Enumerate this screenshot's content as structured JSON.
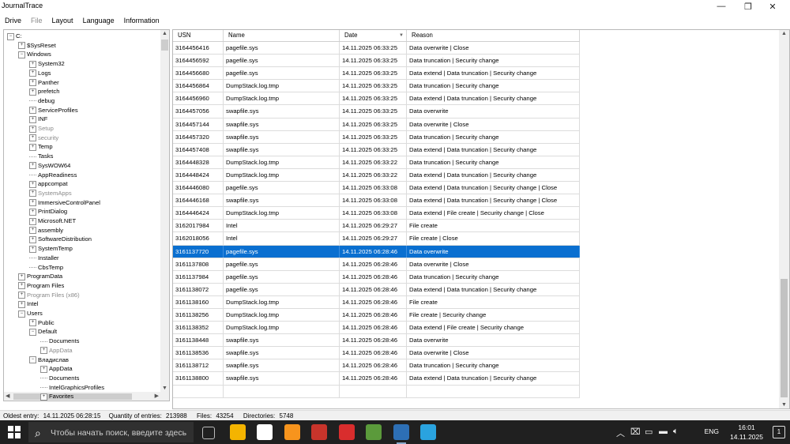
{
  "app": {
    "title": "JournalTrace"
  },
  "window_controls": {
    "minimize": "—",
    "maximize": "❐",
    "close": "✕"
  },
  "menu": [
    {
      "label": "Drive",
      "enabled": true
    },
    {
      "label": "File",
      "enabled": false
    },
    {
      "label": "Layout",
      "enabled": true
    },
    {
      "label": "Language",
      "enabled": true
    },
    {
      "label": "Information",
      "enabled": true
    }
  ],
  "tree": [
    {
      "label": "C:",
      "depth": 0,
      "exp": "−"
    },
    {
      "label": "$SysReset",
      "depth": 1,
      "exp": "+"
    },
    {
      "label": "Windows",
      "depth": 1,
      "exp": "−"
    },
    {
      "label": "System32",
      "depth": 2,
      "exp": "+"
    },
    {
      "label": "Logs",
      "depth": 2,
      "exp": "+"
    },
    {
      "label": "Panther",
      "depth": 2,
      "exp": "+"
    },
    {
      "label": "prefetch",
      "depth": 2,
      "exp": "+"
    },
    {
      "label": "debug",
      "depth": 2,
      "exp": ""
    },
    {
      "label": "ServiceProfiles",
      "depth": 2,
      "exp": "+"
    },
    {
      "label": "INF",
      "depth": 2,
      "exp": "+"
    },
    {
      "label": "Setup",
      "depth": 2,
      "exp": "+",
      "disabled": true
    },
    {
      "label": "security",
      "depth": 2,
      "exp": "+",
      "disabled": true
    },
    {
      "label": "Temp",
      "depth": 2,
      "exp": "+"
    },
    {
      "label": "Tasks",
      "depth": 2,
      "exp": ""
    },
    {
      "label": "SysWOW64",
      "depth": 2,
      "exp": "+"
    },
    {
      "label": "AppReadiness",
      "depth": 2,
      "exp": ""
    },
    {
      "label": "appcompat",
      "depth": 2,
      "exp": "+"
    },
    {
      "label": "SystemApps",
      "depth": 2,
      "exp": "+",
      "disabled": true
    },
    {
      "label": "ImmersiveControlPanel",
      "depth": 2,
      "exp": "+"
    },
    {
      "label": "PrintDialog",
      "depth": 2,
      "exp": "+"
    },
    {
      "label": "Microsoft.NET",
      "depth": 2,
      "exp": "+"
    },
    {
      "label": "assembly",
      "depth": 2,
      "exp": "+"
    },
    {
      "label": "SoftwareDistribution",
      "depth": 2,
      "exp": "+"
    },
    {
      "label": "SystemTemp",
      "depth": 2,
      "exp": "+"
    },
    {
      "label": "Installer",
      "depth": 2,
      "exp": ""
    },
    {
      "label": "CbsTemp",
      "depth": 2,
      "exp": ""
    },
    {
      "label": "ProgramData",
      "depth": 1,
      "exp": "+"
    },
    {
      "label": "Program Files",
      "depth": 1,
      "exp": "+"
    },
    {
      "label": "Program Files (x86)",
      "depth": 1,
      "exp": "+",
      "disabled": true
    },
    {
      "label": "Intel",
      "depth": 1,
      "exp": "+"
    },
    {
      "label": "Users",
      "depth": 1,
      "exp": "−"
    },
    {
      "label": "Public",
      "depth": 2,
      "exp": "+"
    },
    {
      "label": "Default",
      "depth": 2,
      "exp": "−"
    },
    {
      "label": "Documents",
      "depth": 3,
      "exp": ""
    },
    {
      "label": "AppData",
      "depth": 3,
      "exp": "+",
      "disabled": true
    },
    {
      "label": "Владислав",
      "depth": 2,
      "exp": "−"
    },
    {
      "label": "AppData",
      "depth": 3,
      "exp": "+"
    },
    {
      "label": "Documents",
      "depth": 3,
      "exp": ""
    },
    {
      "label": "IntelGraphicsProfiles",
      "depth": 3,
      "exp": ""
    },
    {
      "label": "Favorites",
      "depth": 3,
      "exp": "+"
    }
  ],
  "grid": {
    "columns": [
      "USN",
      "Name",
      "Date",
      "Reason"
    ],
    "sort_indicator": "▼",
    "selected_index": 17,
    "rows": [
      [
        "3164456416",
        "pagefile.sys",
        "14.11.2025 06:33:25",
        "Data overwrite | Close"
      ],
      [
        "3164456592",
        "pagefile.sys",
        "14.11.2025 06:33:25",
        "Data truncation | Security change"
      ],
      [
        "3164456680",
        "pagefile.sys",
        "14.11.2025 06:33:25",
        "Data extend | Data truncation | Security change"
      ],
      [
        "3164456864",
        "DumpStack.log.tmp",
        "14.11.2025 06:33:25",
        "Data truncation | Security change"
      ],
      [
        "3164456960",
        "DumpStack.log.tmp",
        "14.11.2025 06:33:25",
        "Data extend | Data truncation | Security change"
      ],
      [
        "3164457056",
        "swapfile.sys",
        "14.11.2025 06:33:25",
        "Data overwrite"
      ],
      [
        "3164457144",
        "swapfile.sys",
        "14.11.2025 06:33:25",
        "Data overwrite | Close"
      ],
      [
        "3164457320",
        "swapfile.sys",
        "14.11.2025 06:33:25",
        "Data truncation | Security change"
      ],
      [
        "3164457408",
        "swapfile.sys",
        "14.11.2025 06:33:25",
        "Data extend | Data truncation | Security change"
      ],
      [
        "3164448328",
        "DumpStack.log.tmp",
        "14.11.2025 06:33:22",
        "Data truncation | Security change"
      ],
      [
        "3164448424",
        "DumpStack.log.tmp",
        "14.11.2025 06:33:22",
        "Data extend | Data truncation | Security change"
      ],
      [
        "3164446080",
        "pagefile.sys",
        "14.11.2025 06:33:08",
        "Data extend | Data truncation | Security change | Close"
      ],
      [
        "3164446168",
        "swapfile.sys",
        "14.11.2025 06:33:08",
        "Data extend | Data truncation | Security change | Close"
      ],
      [
        "3164446424",
        "DumpStack.log.tmp",
        "14.11.2025 06:33:08",
        "Data extend | File create | Security change | Close"
      ],
      [
        "3162017984",
        "Intel",
        "14.11.2025 06:29:27",
        "File create"
      ],
      [
        "3162018056",
        "Intel",
        "14.11.2025 06:29:27",
        "File create | Close"
      ],
      [
        "3161137720",
        "pagefile.sys",
        "14.11.2025 06:28:46",
        "Data overwrite"
      ],
      [
        "3161137808",
        "pagefile.sys",
        "14.11.2025 06:28:46",
        "Data overwrite | Close"
      ],
      [
        "3161137984",
        "pagefile.sys",
        "14.11.2025 06:28:46",
        "Data truncation | Security change"
      ],
      [
        "3161138072",
        "pagefile.sys",
        "14.11.2025 06:28:46",
        "Data extend | Data truncation | Security change"
      ],
      [
        "3161138160",
        "DumpStack.log.tmp",
        "14.11.2025 06:28:46",
        "File create"
      ],
      [
        "3161138256",
        "DumpStack.log.tmp",
        "14.11.2025 06:28:46",
        "File create | Security change"
      ],
      [
        "3161138352",
        "DumpStack.log.tmp",
        "14.11.2025 06:28:46",
        "Data extend | File create | Security change"
      ],
      [
        "3161138448",
        "swapfile.sys",
        "14.11.2025 06:28:46",
        "Data overwrite"
      ],
      [
        "3161138536",
        "swapfile.sys",
        "14.11.2025 06:28:46",
        "Data overwrite | Close"
      ],
      [
        "3161138712",
        "swapfile.sys",
        "14.11.2025 06:28:46",
        "Data truncation | Security change"
      ],
      [
        "3161138800",
        "swapfile.sys",
        "14.11.2025 06:28:46",
        "Data extend | Data truncation | Security change"
      ]
    ]
  },
  "status": {
    "oldest_label": "Oldest entry:",
    "oldest_value": "14.11.2025 06:28:15",
    "quantity_label": "Quantity of entries:",
    "quantity_value": "213988",
    "files_label": "Files:",
    "files_value": "43254",
    "dirs_label": "Directories:",
    "dirs_value": "5748"
  },
  "taskbar": {
    "search_placeholder": "Чтобы начать поиск, введите здесь",
    "language": "ENG",
    "time": "16:01",
    "date": "14.11.2025",
    "notifications_count": "1",
    "apps": [
      {
        "name": "task-view-icon",
        "color": "#202020"
      },
      {
        "name": "file-explorer-icon",
        "color": "#f4b400"
      },
      {
        "name": "yandex-browser-icon",
        "color": "#ffffff"
      },
      {
        "name": "search-tool-icon",
        "color": "#f7941d"
      },
      {
        "name": "editor-app-icon",
        "color": "#c8342b"
      },
      {
        "name": "media-app-icon",
        "color": "#d92d2d"
      },
      {
        "name": "minecraft-icon",
        "color": "#5b9a3b"
      },
      {
        "name": "journaltrace-icon",
        "color": "#2d6fb5"
      },
      {
        "name": "telegram-icon",
        "color": "#2aa3df"
      }
    ]
  }
}
